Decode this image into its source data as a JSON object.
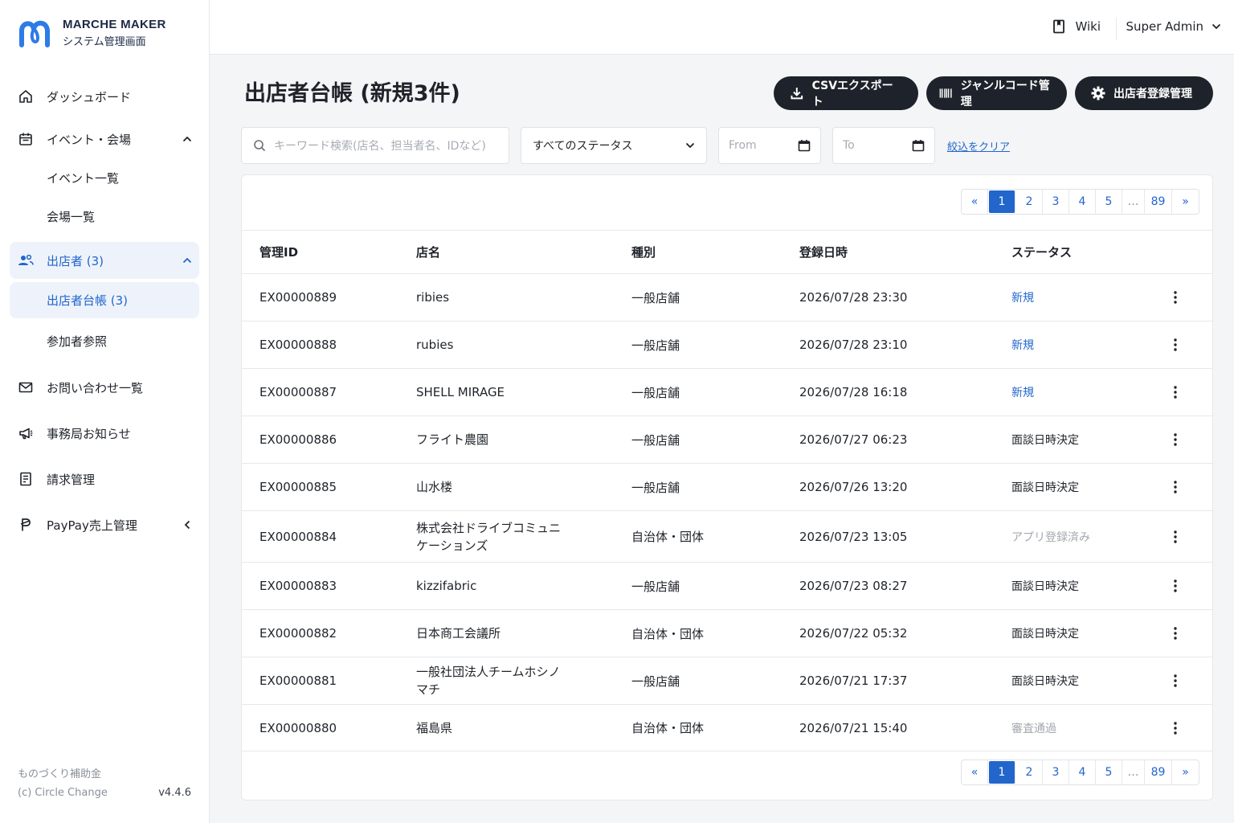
{
  "brand": {
    "name": "MARCHE MAKER",
    "subtitle": "システム管理画面"
  },
  "sidebar": {
    "items": [
      {
        "label": "ダッシュボード",
        "icon": "home-icon"
      },
      {
        "label": "イベント・会場",
        "icon": "calendar-icon",
        "expanded": true
      },
      {
        "label": "イベント一覧"
      },
      {
        "label": "会場一覧"
      },
      {
        "label": "出店者 (3)",
        "icon": "users-icon",
        "expanded": true
      },
      {
        "label": "出店者台帳 (3)"
      },
      {
        "label": "参加者参照"
      },
      {
        "label": "お問い合わせ一覧",
        "icon": "mail-icon"
      },
      {
        "label": "事務局お知らせ",
        "icon": "megaphone-icon"
      },
      {
        "label": "請求管理",
        "icon": "invoice-icon"
      },
      {
        "label": "PayPay売上管理",
        "icon": "paypay-icon",
        "expanded": false
      }
    ],
    "footer": {
      "line1": "ものづくり補助金",
      "copyright": "(c) Circle Change",
      "version": "v4.4.6"
    }
  },
  "topbar": {
    "wiki": "Wiki",
    "user": "Super Admin"
  },
  "page": {
    "title": "出店者台帳 (新規3件)",
    "buttons": {
      "csv": "CSVエクスポート",
      "genre": "ジャンルコード管理",
      "register": "出店者登録管理"
    }
  },
  "filters": {
    "search_placeholder": "キーワード検索(店名、担当者名、IDなど)",
    "status": "すべてのステータス",
    "from": "From",
    "to": "To",
    "clear": "絞込をクリア"
  },
  "pagination": {
    "prev": "«",
    "pages": [
      "1",
      "2",
      "3",
      "4",
      "5"
    ],
    "ellipsis": "…",
    "last": "89",
    "next": "»",
    "current": "1"
  },
  "table": {
    "headers": {
      "id": "管理ID",
      "name": "店名",
      "type": "種別",
      "date": "登録日時",
      "status": "ステータス"
    },
    "rows": [
      {
        "id": "EX00000889",
        "name": "ribies",
        "type": "一般店舗",
        "date": "2026/07/28 23:30",
        "status": "新規"
      },
      {
        "id": "EX00000888",
        "name": "rubies",
        "type": "一般店舗",
        "date": "2026/07/28 23:10",
        "status": "新規"
      },
      {
        "id": "EX00000887",
        "name": "SHELL MIRAGE",
        "type": "一般店舗",
        "date": "2026/07/28 16:18",
        "status": "新規"
      },
      {
        "id": "EX00000886",
        "name": "フライト農園",
        "type": "一般店舗",
        "date": "2026/07/27 06:23",
        "status": "面談日時決定"
      },
      {
        "id": "EX00000885",
        "name": "山水楼",
        "type": "一般店舗",
        "date": "2026/07/26 13:20",
        "status": "面談日時決定"
      },
      {
        "id": "EX00000884",
        "name": "株式会社ドライブコミュニケーションズ",
        "type": "自治体・団体",
        "date": "2026/07/23 13:05",
        "status": "アプリ登録済み"
      },
      {
        "id": "EX00000883",
        "name": "kizzifabric",
        "type": "一般店舗",
        "date": "2026/07/23 08:27",
        "status": "面談日時決定"
      },
      {
        "id": "EX00000882",
        "name": "日本商工会議所",
        "type": "自治体・団体",
        "date": "2026/07/22 05:32",
        "status": "面談日時決定"
      },
      {
        "id": "EX00000881",
        "name": "一般社団法人チームホシノマチ",
        "type": "一般店舗",
        "date": "2026/07/21 17:37",
        "status": "面談日時決定"
      },
      {
        "id": "EX00000880",
        "name": "福島県",
        "type": "自治体・団体",
        "date": "2026/07/21 15:40",
        "status": "審査通過"
      }
    ]
  },
  "colors": {
    "accent": "#2266cc",
    "dark_button": "#1e232b",
    "active_bg": "#eef3fb"
  }
}
